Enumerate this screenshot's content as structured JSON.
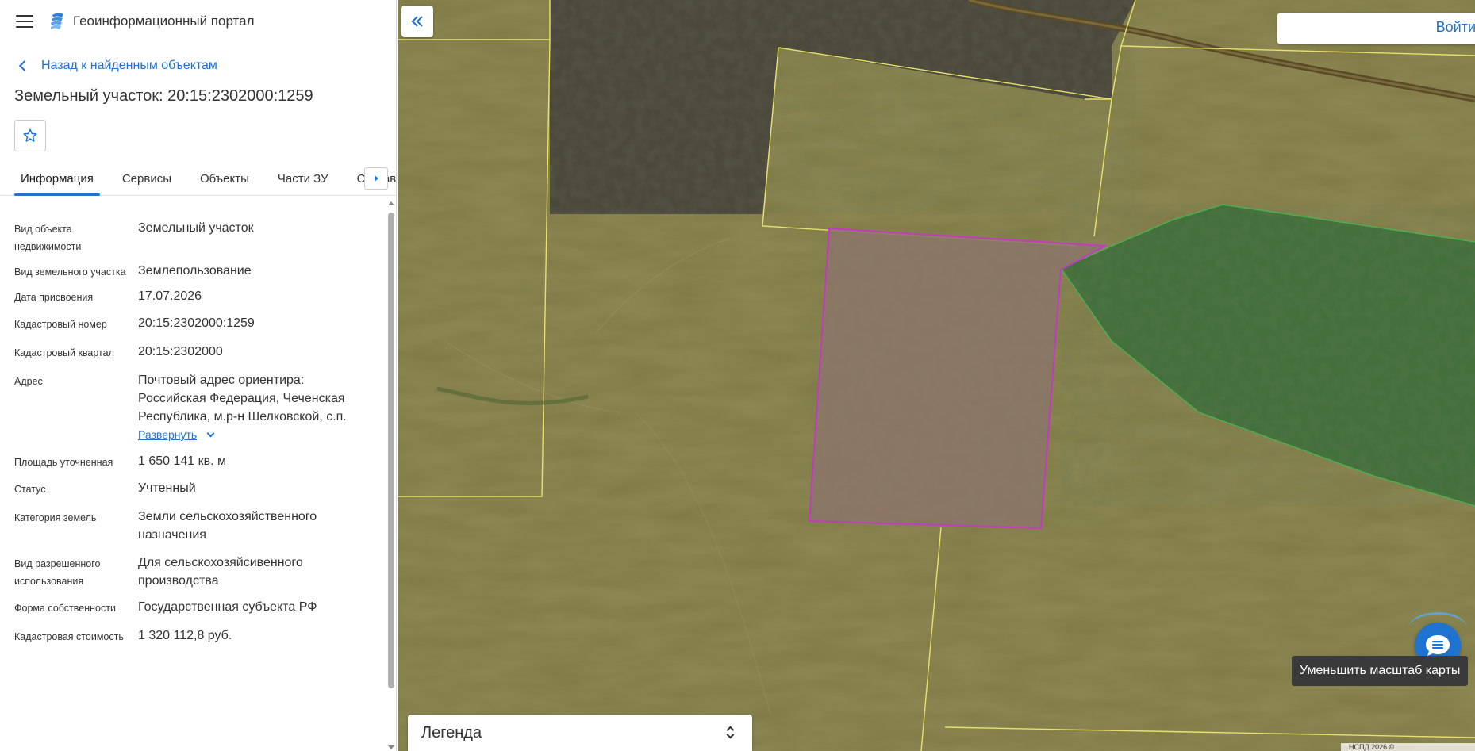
{
  "app": {
    "title": "Геоинформационный портал"
  },
  "nav": {
    "back_label": "Назад к найденным объектам"
  },
  "page": {
    "title": "Земельный участок: 20:15:2302000:1259"
  },
  "tabs": [
    {
      "label": "Информация",
      "active": true
    },
    {
      "label": "Сервисы",
      "active": false
    },
    {
      "label": "Объекты",
      "active": false
    },
    {
      "label": "Части ЗУ",
      "active": false
    },
    {
      "label": "Состав",
      "active": false
    }
  ],
  "properties": [
    {
      "label": "Вид объекта недвижимости",
      "value": "Земельный участок"
    },
    {
      "label": "Вид земельного участка",
      "value": "Землепользование"
    },
    {
      "label": "Дата присвоения",
      "value": "17.07.2026"
    },
    {
      "label": "Кадастровый номер",
      "value": "20:15:2302000:1259"
    },
    {
      "label": "Кадастровый квартал",
      "value": "20:15:2302000"
    },
    {
      "label": "Адрес",
      "value": "Почтовый адрес ориентира: Российская Федерация, Чеченская Республика, м.р-н Шелковской, с.п.",
      "expand_label": "Развернуть"
    },
    {
      "label": "Площадь уточненная",
      "value": "1 650 141 кв. м"
    },
    {
      "label": "Статус",
      "value": "Учтенный"
    },
    {
      "label": "Категория земель",
      "value": "Земли сельскохозяйственного назначения"
    },
    {
      "label": "Вид разрешенного использования",
      "value": "Для сельскохозяйсивенного производства"
    },
    {
      "label": "Форма собственности",
      "value": "Государственная субъекта РФ"
    },
    {
      "label": "Кадастровая стоимость",
      "value": "1 320 112,8 руб."
    }
  ],
  "map": {
    "login_label": "Войти",
    "legend_label": "Легенда",
    "tooltip": "Уменьшить масштаб карты",
    "attribution": "НСПД 2026 ©",
    "colors": {
      "terrain": "#7d7845",
      "dark_parcel": "#4a473d",
      "green_parcel": "#3c6e3a",
      "selected_fill": "#8a7466",
      "selected_stroke": "#c23bc2",
      "boundary": "#e8e06a"
    }
  },
  "icons": {
    "menu": "menu-icon",
    "logo": "portal-logo-icon",
    "back": "chevron-left-icon",
    "favorite": "star-icon",
    "tabs_next": "chevron-right-icon",
    "collapse": "double-chevron-left-icon",
    "chat": "chat-icon",
    "legend_toggle": "chevron-up-down-icon"
  },
  "accent_color": "#1e73d0"
}
